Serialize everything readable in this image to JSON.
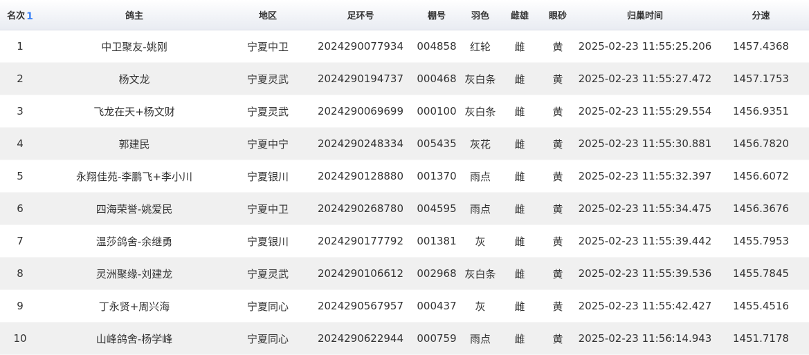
{
  "table": {
    "headers": {
      "rank": "名次",
      "owner": "鸽主",
      "region": "地区",
      "ring": "足环号",
      "shed": "棚号",
      "color": "羽色",
      "sex": "雌雄",
      "eye": "眼砂",
      "time": "归巢时间",
      "speed": "分速"
    },
    "sort_icon": "sort-ascending-icon",
    "sort_glyph": "1",
    "rows": [
      {
        "rank": "1",
        "owner": "中卫聚友-姚刚",
        "region": "宁夏中卫",
        "ring": "2024290077934",
        "shed": "004858",
        "color": "红轮",
        "sex": "雌",
        "eye": "黄",
        "time": "2025-02-23 11:55:25.206",
        "speed": "1457.4368"
      },
      {
        "rank": "2",
        "owner": "杨文龙",
        "region": "宁夏灵武",
        "ring": "2024290194737",
        "shed": "000468",
        "color": "灰白条",
        "sex": "雌",
        "eye": "黄",
        "time": "2025-02-23 11:55:27.472",
        "speed": "1457.1753"
      },
      {
        "rank": "3",
        "owner": "飞龙在天+杨文财",
        "region": "宁夏灵武",
        "ring": "2024290069699",
        "shed": "000100",
        "color": "灰白条",
        "sex": "雌",
        "eye": "黄",
        "time": "2025-02-23 11:55:29.554",
        "speed": "1456.9351"
      },
      {
        "rank": "4",
        "owner": "郭建民",
        "region": "宁夏中宁",
        "ring": "2024290248334",
        "shed": "005435",
        "color": "灰花",
        "sex": "雌",
        "eye": "黄",
        "time": "2025-02-23 11:55:30.881",
        "speed": "1456.7820"
      },
      {
        "rank": "5",
        "owner": "永翔佳苑-李鹏飞+李小川",
        "region": "宁夏银川",
        "ring": "2024290128880",
        "shed": "001370",
        "color": "雨点",
        "sex": "雌",
        "eye": "黄",
        "time": "2025-02-23 11:55:32.397",
        "speed": "1456.6072"
      },
      {
        "rank": "6",
        "owner": "四海荣誉-姚爱民",
        "region": "宁夏中卫",
        "ring": "2024290268780",
        "shed": "004595",
        "color": "雨点",
        "sex": "雌",
        "eye": "黄",
        "time": "2025-02-23 11:55:34.475",
        "speed": "1456.3676"
      },
      {
        "rank": "7",
        "owner": "温莎鸽舍-余继勇",
        "region": "宁夏银川",
        "ring": "2024290177792",
        "shed": "001381",
        "color": "灰",
        "sex": "雌",
        "eye": "黄",
        "time": "2025-02-23 11:55:39.442",
        "speed": "1455.7953"
      },
      {
        "rank": "8",
        "owner": "灵洲聚缘-刘建龙",
        "region": "宁夏灵武",
        "ring": "2024290106612",
        "shed": "002968",
        "color": "灰白条",
        "sex": "雌",
        "eye": "黄",
        "time": "2025-02-23 11:55:39.536",
        "speed": "1455.7845"
      },
      {
        "rank": "9",
        "owner": "丁永贤+周兴海",
        "region": "宁夏同心",
        "ring": "2024290567957",
        "shed": "000437",
        "color": "灰",
        "sex": "雌",
        "eye": "黄",
        "time": "2025-02-23 11:55:42.427",
        "speed": "1455.4516"
      },
      {
        "rank": "10",
        "owner": "山峰鸽舍-杨学峰",
        "region": "宁夏同心",
        "ring": "2024290622944",
        "shed": "000759",
        "color": "雨点",
        "sex": "雌",
        "eye": "黄",
        "time": "2025-02-23 11:56:14.943",
        "speed": "1451.7178"
      }
    ]
  }
}
